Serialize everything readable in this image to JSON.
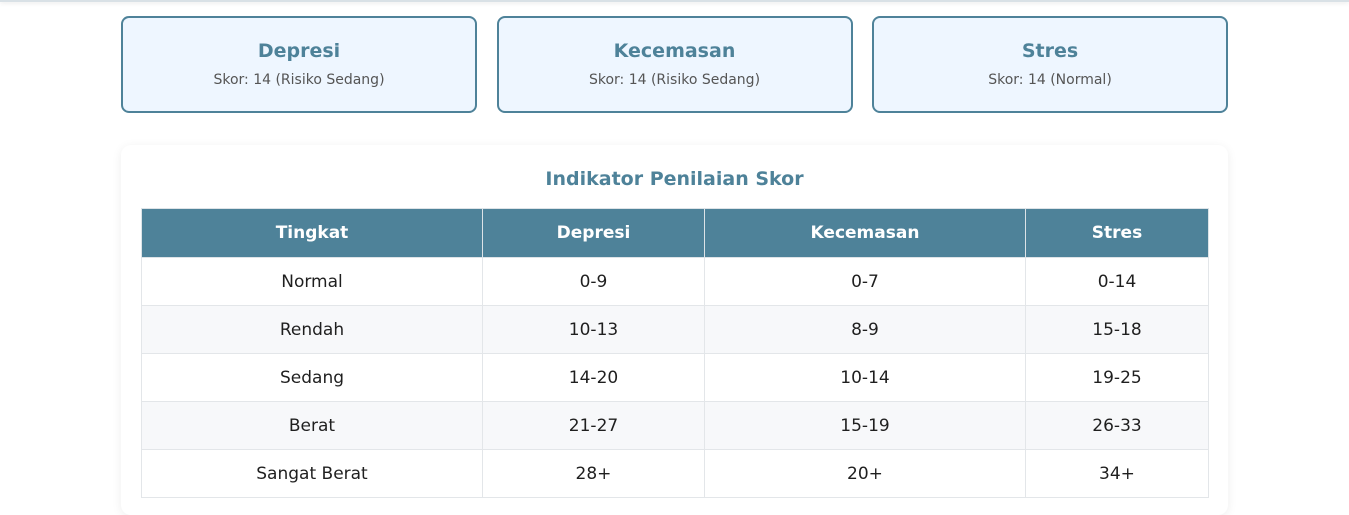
{
  "summary_cards": [
    {
      "title": "Depresi",
      "score": "Skor: 14 (Risiko Sedang)"
    },
    {
      "title": "Kecemasan",
      "score": "Skor: 14 (Risiko Sedang)"
    },
    {
      "title": "Stres",
      "score": "Skor: 14 (Normal)"
    }
  ],
  "indicator": {
    "title": "Indikator Penilaian Skor",
    "headers": [
      "Tingkat",
      "Depresi",
      "Kecemasan",
      "Stres"
    ],
    "rows": [
      [
        "Normal",
        "0-9",
        "0-7",
        "0-14"
      ],
      [
        "Rendah",
        "10-13",
        "8-9",
        "15-18"
      ],
      [
        "Sedang",
        "14-20",
        "10-14",
        "19-25"
      ],
      [
        "Berat",
        "21-27",
        "15-19",
        "26-33"
      ],
      [
        "Sangat Berat",
        "28+",
        "20+",
        "34+"
      ]
    ]
  },
  "colors": {
    "accent": "#4e8299",
    "card_background": "#eef6ff"
  }
}
